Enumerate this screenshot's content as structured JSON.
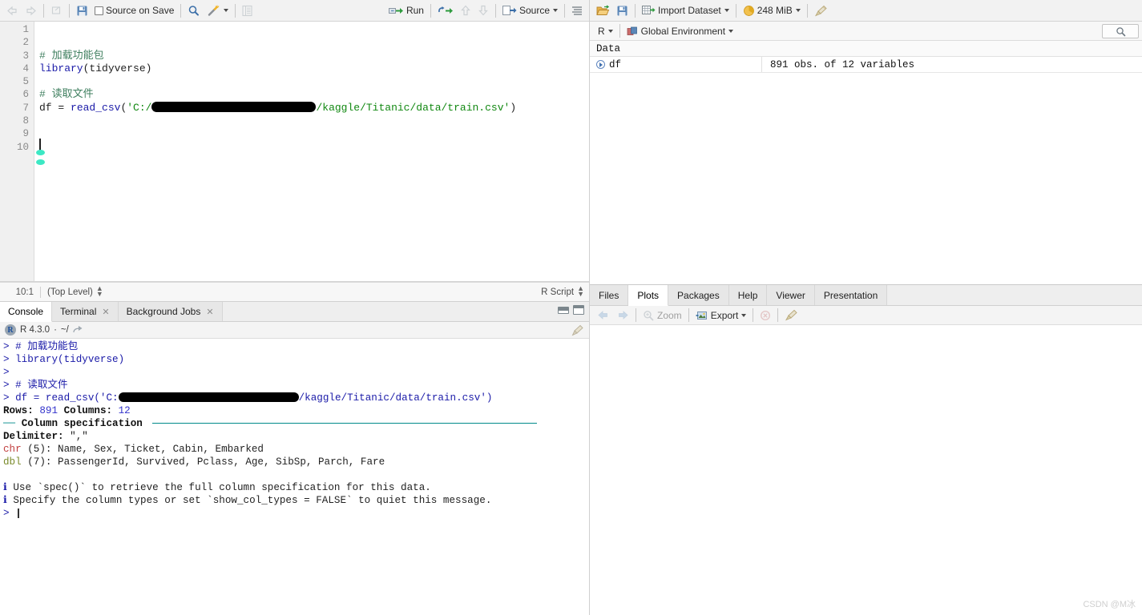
{
  "source_toolbar": {
    "back_icon": "arrow-left-icon",
    "forward_icon": "arrow-right-icon",
    "show_doc_outline_icon": "popout-icon",
    "save_icon": "save-icon",
    "source_on_save_label": "Source on Save",
    "find_icon": "magnifier-icon",
    "code_tools_icon": "magic-wand-icon",
    "compile_report_icon": "notebook-icon",
    "run_label": "Run",
    "rerun_icon": "rerun-icon",
    "prev_chunk_icon": "arrow-up-icon",
    "next_chunk_icon": "arrow-down-icon",
    "source_label": "Source",
    "outline_icon": "outline-lines-icon"
  },
  "editor": {
    "line_numbers": [
      "1",
      "2",
      "3",
      "4",
      "5",
      "6",
      "7",
      "8",
      "9",
      "10"
    ],
    "lines": [
      {
        "n": 1,
        "tokens": []
      },
      {
        "n": 2,
        "tokens": []
      },
      {
        "n": 3,
        "tokens": [
          {
            "t": "comment",
            "s": "# 加载功能包"
          }
        ]
      },
      {
        "n": 4,
        "tokens": [
          {
            "t": "fn",
            "s": "library"
          },
          {
            "t": "plain",
            "s": "(tidyverse)"
          }
        ]
      },
      {
        "n": 5,
        "tokens": []
      },
      {
        "n": 6,
        "tokens": [
          {
            "t": "comment",
            "s": "# 读取文件"
          }
        ]
      },
      {
        "n": 7,
        "tokens": [
          {
            "t": "plain",
            "s": "df = "
          },
          {
            "t": "fn",
            "s": "read_csv"
          },
          {
            "t": "plain",
            "s": "("
          },
          {
            "t": "str",
            "s": "'C:/"
          },
          {
            "t": "redact",
            "s": ""
          },
          {
            "t": "str",
            "s": "/kaggle/Titanic/data/train.csv'"
          },
          {
            "t": "plain",
            "s": ")"
          }
        ]
      },
      {
        "n": 8,
        "tokens": []
      },
      {
        "n": 9,
        "tokens": []
      },
      {
        "n": 10,
        "tokens": []
      }
    ]
  },
  "source_status": {
    "cursor_position": "10:1",
    "scope": "(Top Level)",
    "file_type": "R Script"
  },
  "console_pane": {
    "tabs": [
      {
        "label": "Console",
        "active": true,
        "closable": false
      },
      {
        "label": "Terminal",
        "active": false,
        "closable": true
      },
      {
        "label": "Background Jobs",
        "active": false,
        "closable": true
      }
    ],
    "minimize_icon": "minimize-icon",
    "maximize_icon": "maximize-icon",
    "r_logo": "R",
    "r_version": "R 4.3.0",
    "separator": "·",
    "working_dir": "~/",
    "open_dir_icon": "open-folder-arrow-icon",
    "clear_console_icon": "broom-icon",
    "output_lines": [
      {
        "segs": [
          {
            "c": "prompt",
            "s": "> "
          },
          {
            "c": "blue",
            "s": "# 加载功能包"
          }
        ]
      },
      {
        "segs": [
          {
            "c": "prompt",
            "s": "> "
          },
          {
            "c": "blue",
            "s": "library(tidyverse)"
          }
        ]
      },
      {
        "segs": [
          {
            "c": "prompt",
            "s": ">"
          }
        ]
      },
      {
        "segs": [
          {
            "c": "prompt",
            "s": "> "
          },
          {
            "c": "blue",
            "s": "# 读取文件"
          }
        ]
      },
      {
        "segs": [
          {
            "c": "prompt",
            "s": "> "
          },
          {
            "c": "blue",
            "s": "df = read_csv('C:"
          },
          {
            "c": "redact",
            "s": ""
          },
          {
            "c": "blue",
            "s": "/kaggle/Titanic/data/train.csv')"
          }
        ]
      },
      {
        "segs": [
          {
            "c": "black",
            "s": "Rows: "
          },
          {
            "c": "num",
            "s": "891"
          },
          {
            "c": "black",
            "s": " Columns: "
          },
          {
            "c": "num",
            "s": "12"
          }
        ]
      },
      {
        "segs": [
          {
            "c": "teal",
            "s": "── "
          },
          {
            "c": "black",
            "s": "Column specification "
          },
          {
            "c": "rule",
            "s": ""
          }
        ]
      },
      {
        "segs": [
          {
            "c": "black",
            "s": "Delimiter: "
          },
          {
            "c": "grey",
            "s": "\",\""
          }
        ]
      },
      {
        "segs": [
          {
            "c": "red",
            "s": "chr"
          },
          {
            "c": "grey",
            "s": " (5): Name, Sex, Ticket, Cabin, Embarked"
          }
        ]
      },
      {
        "segs": [
          {
            "c": "olive",
            "s": "dbl"
          },
          {
            "c": "grey",
            "s": " (7): PassengerId, Survived, Pclass, Age, SibSp, Parch, Fare"
          }
        ]
      },
      {
        "segs": []
      },
      {
        "segs": [
          {
            "c": "blue",
            "s": "ℹ "
          },
          {
            "c": "grey",
            "s": "Use `spec()` to retrieve the full column specification for this data."
          }
        ]
      },
      {
        "segs": [
          {
            "c": "blue",
            "s": "ℹ "
          },
          {
            "c": "grey",
            "s": "Specify the column types or set `show_col_types = FALSE` to quiet this message."
          }
        ]
      },
      {
        "segs": [
          {
            "c": "prompt",
            "s": "> "
          },
          {
            "c": "caret",
            "s": ""
          }
        ]
      }
    ]
  },
  "environment_pane": {
    "toolbar": {
      "load_workspace_icon": "open-folder-icon",
      "save_workspace_icon": "save-icon",
      "import_dataset_label": "Import Dataset",
      "memory_usage_label": "248 MiB",
      "memory_icon": "memory-pie-icon",
      "clear_objects_icon": "broom-icon"
    },
    "language_label": "R",
    "scope_icon": "cube-icon",
    "scope_label": "Global Environment",
    "search_icon": "search-icon",
    "group_header": "Data",
    "objects": [
      {
        "expander_icon": "expand-circle-icon",
        "name": "df",
        "value": "891 obs. of 12 variables"
      }
    ]
  },
  "files_pane": {
    "tabs": [
      {
        "label": "Files",
        "active": false
      },
      {
        "label": "Plots",
        "active": true
      },
      {
        "label": "Packages",
        "active": false
      },
      {
        "label": "Help",
        "active": false
      },
      {
        "label": "Viewer",
        "active": false
      },
      {
        "label": "Presentation",
        "active": false
      }
    ],
    "toolbar": {
      "back_icon": "arrow-left-icon",
      "forward_icon": "arrow-right-icon",
      "zoom_label": "Zoom",
      "zoom_icon": "magnifier-plus-icon",
      "export_label": "Export",
      "export_icon": "export-image-icon",
      "remove_plot_icon": "remove-circle-icon",
      "clear_plots_icon": "broom-icon"
    }
  },
  "watermark": "CSDN @M冰",
  "colors": {
    "comment": "#3f7f5f",
    "function": "#1a1aa8",
    "string": "#118811",
    "console_prompt": "#1a1aa8",
    "teal_rule": "#008b8b",
    "chr_type": "#c24040",
    "dbl_type": "#7a8a2a",
    "number": "#3333cc",
    "cursor_marker": "#3ce8c4",
    "toolbar_bg": "#f2f2f2",
    "run_arrow": "#2e9b3e"
  }
}
